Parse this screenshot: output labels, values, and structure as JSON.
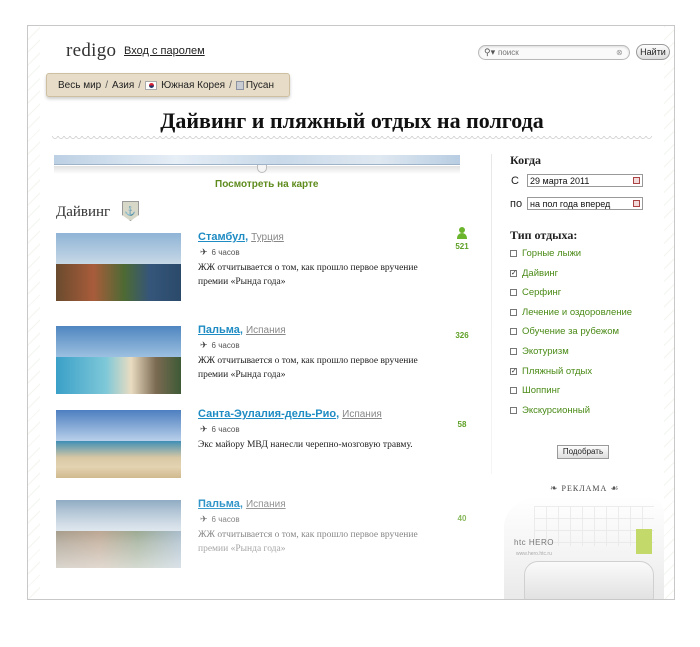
{
  "header": {
    "logo": "redigo",
    "login_link": "Вход с паролем",
    "search_placeholder": "поиск",
    "find_button": "Найти"
  },
  "breadcrumb": [
    "Весь мир",
    "Азия",
    "Южная Корея",
    "Пусан"
  ],
  "page_title": "Дайвинг и пляжный отдых на полгода",
  "map_link": "Посмотреть на карте",
  "section": {
    "title": "Дайвинг",
    "icon": "diving-badge-icon"
  },
  "items": [
    {
      "city": "Стамбул",
      "comma": ",",
      "country": "Турция",
      "time": "6 часов",
      "desc": "ЖЖ отчитывается о том, как прошло первое вручение премии «Рында года»",
      "count": "521",
      "show_user_icon": true
    },
    {
      "city": "Пальма",
      "comma": ",",
      "country": "Испания",
      "time": "6 часов",
      "desc": "ЖЖ отчитывается о том, как прошло первое вручение премии «Рында года»",
      "count": "326",
      "show_user_icon": false
    },
    {
      "city": "Санта-Эулалия-дель-Рио",
      "comma": ",",
      "country": "Испания",
      "time": "6 часов",
      "desc": "Экс майору МВД нанесли черепно-мозговую травму.",
      "count": "58",
      "show_user_icon": false
    },
    {
      "city": "Пальма",
      "comma": ",",
      "country": "Испания",
      "time": "6 часов",
      "desc": "ЖЖ отчитывается о том, как прошло первое вручение премии «Рында года»",
      "count": "40",
      "show_user_icon": false
    }
  ],
  "sidebar": {
    "when_title": "Когда",
    "from_label": "С",
    "from_value": "29 марта 2011",
    "to_label": "по",
    "to_value": "на пол года вперед",
    "type_title": "Тип отдыха:",
    "types": [
      {
        "label": "Горные лыжи",
        "checked": false
      },
      {
        "label": "Дайвинг",
        "checked": true
      },
      {
        "label": "Серфинг",
        "checked": false
      },
      {
        "label": "Лечение и оздоровление",
        "checked": false
      },
      {
        "label": "Обучение за рубежом",
        "checked": false
      },
      {
        "label": "Экотуризм",
        "checked": false
      },
      {
        "label": "Пляжный отдых",
        "checked": true
      },
      {
        "label": "Шоппинг",
        "checked": false
      },
      {
        "label": "Экскурсионный",
        "checked": false
      }
    ],
    "pick_button": "Подобрать",
    "ad_label": "РЕКЛАМА",
    "ad_brand": "htc HERO",
    "ad_url": "www.hero.htc.ru"
  },
  "colors": {
    "link_blue": "#1e8bc3",
    "green": "#5e8b1c",
    "breadcrumb_bg": "#e7dcc8"
  }
}
